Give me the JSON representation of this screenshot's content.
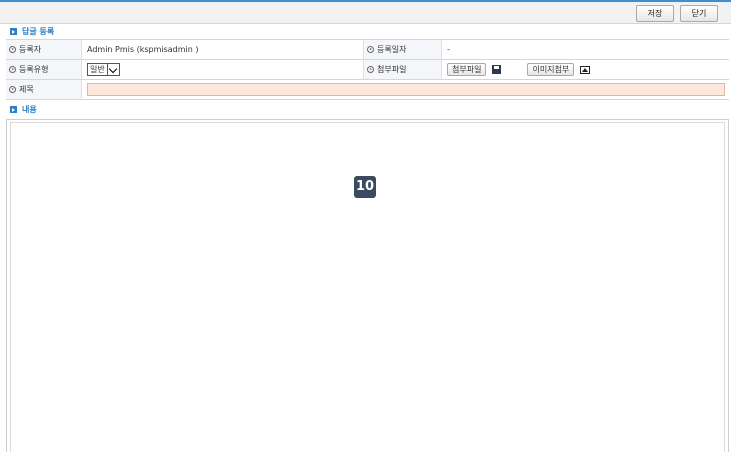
{
  "toolbar": {
    "save_label": "저장",
    "close_label": "닫기"
  },
  "sections": {
    "reply_register": "답글 등록",
    "content": "내용"
  },
  "form": {
    "registrant_label": "등록자",
    "registrant_value": "Admin Pmis (kspmisadmin )",
    "reg_date_label": "등록일자",
    "reg_date_value": "-",
    "reg_type_label": "등록유형",
    "reg_type_value": "일반",
    "attachment_label": "첨부파일",
    "attach_button": "첨부파일",
    "image_attach_button": "이미지첨부",
    "title_label": "제목",
    "title_value": ""
  },
  "badge": "10",
  "icons": {
    "save_disk": "save-disk-icon",
    "image": "image-icon"
  },
  "colors": {
    "accent": "#2b7fc6",
    "title_input_bg": "#fde7da",
    "badge_bg": "#3b4a60"
  }
}
